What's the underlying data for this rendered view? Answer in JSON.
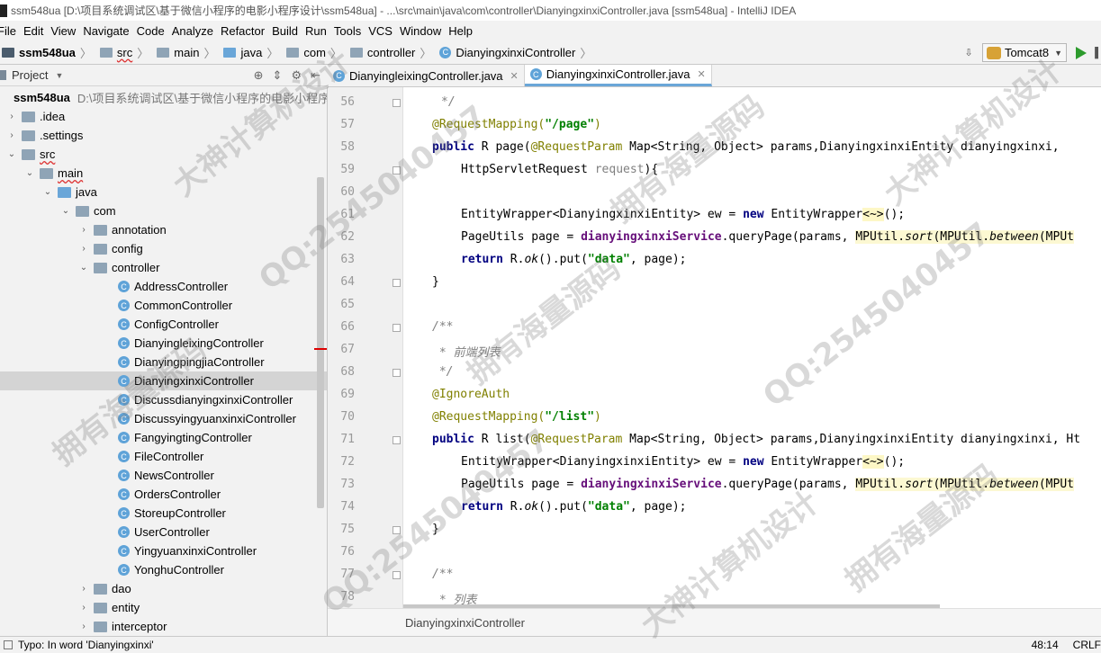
{
  "window": {
    "title": "ssm548ua [D:\\项目系统调试区\\基于微信小程序的电影小程序设计\\ssm548ua] - ...\\src\\main\\java\\com\\controller\\DianyingxinxiController.java [ssm548ua] - IntelliJ IDEA"
  },
  "menu": [
    "File",
    "Edit",
    "View",
    "Navigate",
    "Code",
    "Analyze",
    "Refactor",
    "Build",
    "Run",
    "Tools",
    "VCS",
    "Window",
    "Help"
  ],
  "breadcrumbs": [
    "ssm548ua",
    "src",
    "main",
    "java",
    "com",
    "controller",
    "DianyingxinxiController"
  ],
  "toolbar": {
    "run_config": "Tomcat8"
  },
  "project_panel": {
    "title": "Project",
    "root_name": "ssm548ua",
    "root_path": "D:\\项目系统调试区\\基于微信小程序的电影小程序设",
    "items": [
      {
        "label": ".idea"
      },
      {
        "label": ".settings"
      },
      {
        "label": "src"
      },
      {
        "label": "main"
      },
      {
        "label": "java"
      },
      {
        "label": "com"
      },
      {
        "label": "annotation"
      },
      {
        "label": "config"
      },
      {
        "label": "controller"
      },
      {
        "label": "AddressController"
      },
      {
        "label": "CommonController"
      },
      {
        "label": "ConfigController"
      },
      {
        "label": "DianyingleixingController"
      },
      {
        "label": "DianyingpingjiaController"
      },
      {
        "label": "DianyingxinxiController"
      },
      {
        "label": "DiscussdianyingxinxiController"
      },
      {
        "label": "DiscussyingyuanxinxiController"
      },
      {
        "label": "FangyingtingController"
      },
      {
        "label": "FileController"
      },
      {
        "label": "NewsController"
      },
      {
        "label": "OrdersController"
      },
      {
        "label": "StoreupController"
      },
      {
        "label": "UserController"
      },
      {
        "label": "YingyuanxinxiController"
      },
      {
        "label": "YonghuController"
      },
      {
        "label": "dao"
      },
      {
        "label": "entity"
      },
      {
        "label": "interceptor"
      }
    ]
  },
  "editor_tabs": [
    {
      "label": "DianyingleixingController.java",
      "active": false
    },
    {
      "label": "DianyingxinxiController.java",
      "active": true
    }
  ],
  "line_numbers": [
    "56",
    "57",
    "58",
    "59",
    "60",
    "61",
    "62",
    "63",
    "64",
    "65",
    "66",
    "67",
    "68",
    "69",
    "70",
    "71",
    "72",
    "73",
    "74",
    "75",
    "76",
    "77",
    "78"
  ],
  "code": {
    "l56": "*/",
    "l57_ann": "@RequestMapping(",
    "l57_str": "\"/page\"",
    "l57_end": ")",
    "l58_kw": "public",
    "l58_a": " R page(",
    "l58_ann": "@RequestParam",
    "l58_b": " Map<String, Object> params,DianyingxinxiEntity dianyingxinxi,",
    "l59_a": "HttpServletRequest ",
    "l59_gray": "request",
    "l59_b": "){",
    "l61_a": "EntityWrapper<DianyingxinxiEntity> ew = ",
    "l61_kw": "new",
    "l61_b": " EntityWrapper",
    "l61_hl": "<~>",
    "l61_c": "();",
    "l62_a": "PageUtils page = ",
    "l62_fld": "dianyingxinxiService",
    "l62_b": ".queryPage(params, ",
    "l62_hl_a": "MPUtil.",
    "l62_hl_sort": "sort",
    "l62_hl_b": "(MPUtil.",
    "l62_hl_between": "between",
    "l62_hl_c": "(MPUt",
    "l63_kw": "return",
    "l63_a": " R.",
    "l63_ok": "ok",
    "l63_b": "().put(",
    "l63_str": "\"data\"",
    "l63_c": ", page);",
    "l64": "}",
    "l66": "/**",
    "l67": " * 前端列表",
    "l68": " */",
    "l69": "@IgnoreAuth",
    "l70_ann": "@RequestMapping(",
    "l70_str": "\"/list\"",
    "l70_end": ")",
    "l71_kw": "public",
    "l71_a": " R list(",
    "l71_ann": "@RequestParam",
    "l71_b": " Map<String, Object> params,DianyingxinxiEntity dianyingxinxi, Ht",
    "l72_a": "EntityWrapper<DianyingxinxiEntity> ew = ",
    "l72_kw": "new",
    "l72_b": " EntityWrapper",
    "l72_hl": "<~>",
    "l72_c": "();",
    "l73_a": "PageUtils page = ",
    "l73_fld": "dianyingxinxiService",
    "l73_b": ".queryPage(params, ",
    "l73_hl_a": "MPUtil.",
    "l73_hl_sort": "sort",
    "l73_hl_b": "(MPUtil.",
    "l73_hl_between": "between",
    "l73_hl_c": "(MPUt",
    "l74_kw": "return",
    "l74_a": " R.",
    "l74_ok": "ok",
    "l74_b": "().put(",
    "l74_str": "\"data\"",
    "l74_c": ", page);",
    "l75": "}",
    "l77": "/**",
    "l78": " * 列表"
  },
  "editor_breadcrumb": "DianyingxinxiController",
  "statusbar": {
    "message": "Typo: In word 'Dianyingxinxi'",
    "position": "48:14",
    "line_sep": "CRLF"
  },
  "watermarks": [
    "大神计算机设计",
    "QQ:2545040457",
    "拥有海量源码"
  ]
}
